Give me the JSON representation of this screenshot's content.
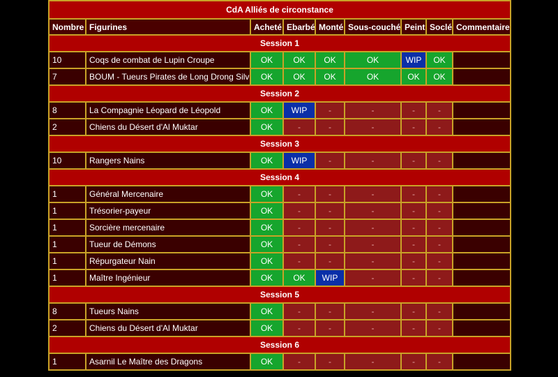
{
  "title": "CdA Alliés de circonstance",
  "headers": [
    "Nombre",
    "Figurines",
    "Acheté",
    "Ebarbé",
    "Monté",
    "Sous-couché",
    "Peint",
    "Soclé",
    "Commentaire"
  ],
  "colors": {
    "ok": "#16a52d",
    "wip": "#0a2fa8",
    "dash": "#8e1a1a",
    "session": "#b00000",
    "row": "#3a0000",
    "border": "#c9a227"
  },
  "sessions": [
    {
      "label": "Session 1",
      "rows": [
        {
          "n": "10",
          "name": "Coqs de combat de Lupin Croupe",
          "s": [
            "OK",
            "OK",
            "OK",
            "OK",
            "WIP",
            "OK"
          ]
        },
        {
          "n": "7",
          "name": "BOUM - Tueurs Pirates de Long Drong Silver",
          "s": [
            "OK",
            "OK",
            "OK",
            "OK",
            "OK",
            "OK"
          ]
        }
      ]
    },
    {
      "label": "Session 2",
      "rows": [
        {
          "n": "8",
          "name": "La Compagnie Léopard de Léopold",
          "s": [
            "OK",
            "WIP",
            "-",
            "-",
            "-",
            "-"
          ]
        },
        {
          "n": "2",
          "name": "Chiens du Désert d'Al Muktar",
          "s": [
            "OK",
            "-",
            "-",
            "-",
            "-",
            "-"
          ]
        }
      ]
    },
    {
      "label": "Session 3",
      "rows": [
        {
          "n": "10",
          "name": "Rangers Nains",
          "s": [
            "OK",
            "WIP",
            "-",
            "-",
            "-",
            "-"
          ]
        }
      ]
    },
    {
      "label": "Session 4",
      "rows": [
        {
          "n": "1",
          "name": "Général Mercenaire",
          "s": [
            "OK",
            "-",
            "-",
            "-",
            "-",
            "-"
          ]
        },
        {
          "n": "1",
          "name": "Trésorier-payeur",
          "s": [
            "OK",
            "-",
            "-",
            "-",
            "-",
            "-"
          ]
        },
        {
          "n": "1",
          "name": "Sorcière mercenaire",
          "s": [
            "OK",
            "-",
            "-",
            "-",
            "-",
            "-"
          ]
        },
        {
          "n": "1",
          "name": "Tueur de Démons",
          "s": [
            "OK",
            "-",
            "-",
            "-",
            "-",
            "-"
          ]
        },
        {
          "n": "1",
          "name": "Répurgateur Nain",
          "s": [
            "OK",
            "-",
            "-",
            "-",
            "-",
            "-"
          ]
        },
        {
          "n": "1",
          "name": "Maître Ingénieur",
          "s": [
            "OK",
            "OK",
            "WIP",
            "-",
            "-",
            "-"
          ]
        }
      ]
    },
    {
      "label": "Session 5",
      "rows": [
        {
          "n": "8",
          "name": "Tueurs Nains",
          "s": [
            "OK",
            "-",
            "-",
            "-",
            "-",
            "-"
          ]
        },
        {
          "n": "2",
          "name": "Chiens du Désert d'Al Muktar",
          "s": [
            "OK",
            "-",
            "-",
            "-",
            "-",
            "-"
          ]
        }
      ]
    },
    {
      "label": "Session 6",
      "rows": [
        {
          "n": "1",
          "name": "Asarnil Le Maître des Dragons",
          "s": [
            "OK",
            "-",
            "-",
            "-",
            "-",
            "-"
          ]
        }
      ]
    }
  ]
}
